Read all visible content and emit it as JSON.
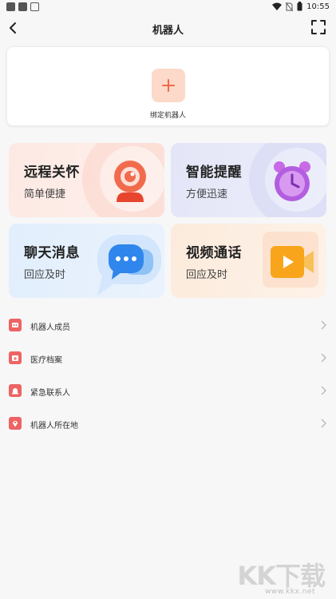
{
  "status_bar": {
    "time": "10:55"
  },
  "header": {
    "title": "机器人"
  },
  "bind": {
    "label": "绑定机器人"
  },
  "cards": [
    {
      "title": "远程关怀",
      "subtitle": "简单便捷",
      "icon": "camera-icon"
    },
    {
      "title": "智能提醒",
      "subtitle": "方便迅速",
      "icon": "alarm-clock-icon"
    },
    {
      "title": "聊天消息",
      "subtitle": "回应及时",
      "icon": "chat-bubble-icon"
    },
    {
      "title": "视频通话",
      "subtitle": "回应及时",
      "icon": "video-icon"
    }
  ],
  "menu": [
    {
      "label": "机器人成员",
      "icon": "robot-members-icon"
    },
    {
      "label": "医疗档案",
      "icon": "medical-record-icon"
    },
    {
      "label": "紧急联系人",
      "icon": "emergency-contact-icon"
    },
    {
      "label": "机器人所在地",
      "icon": "location-pin-icon"
    }
  ],
  "watermark": {
    "brand": "KK下载",
    "url": "www.kkx.net"
  },
  "colors": {
    "accent": "#ee6363",
    "background": "#f7f7f8"
  }
}
